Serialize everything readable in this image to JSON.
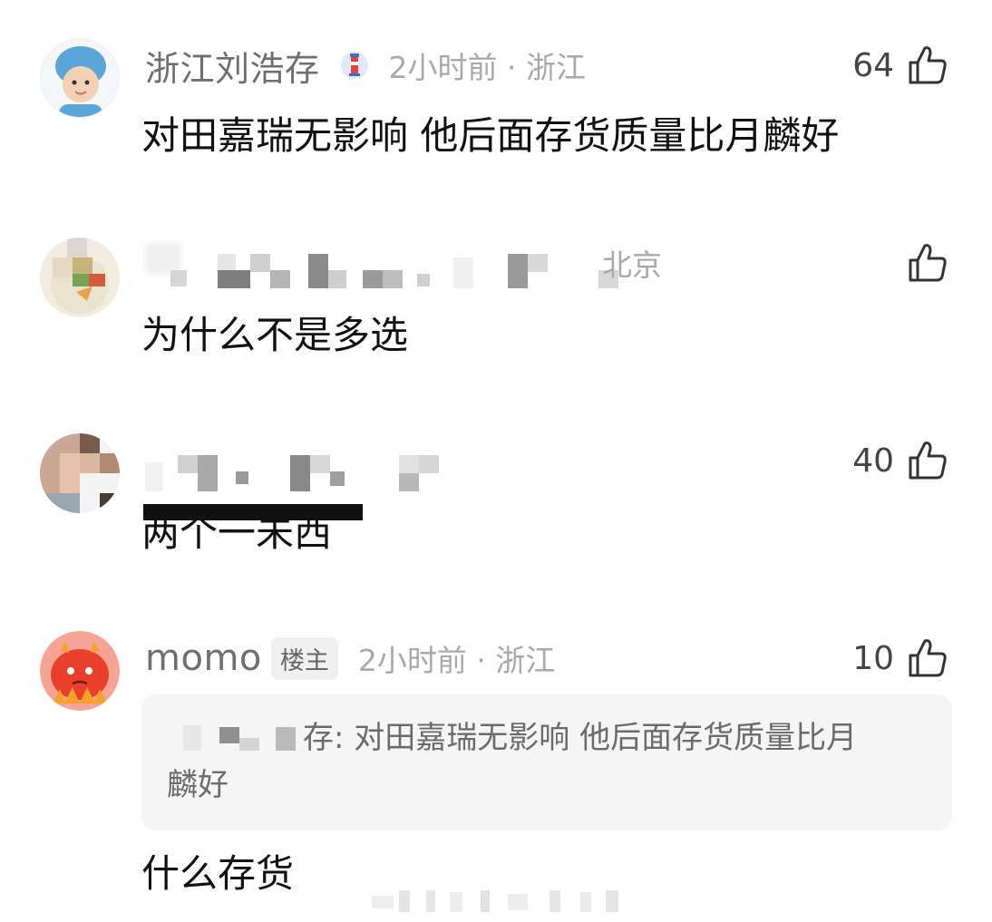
{
  "comments": [
    {
      "username": "浙江刘浩存",
      "time_location": "2小时前 · 浙江",
      "likes": "64",
      "text": "对田嘉瑞无影响 他后面存货质量比月麟好",
      "badge_icon": "lighthouse-badge-icon"
    },
    {
      "username": "",
      "time_location": "北京",
      "likes": "",
      "text": "为什么不是多选"
    },
    {
      "username": "",
      "time_location": "",
      "likes": "40",
      "text": "两个一未西"
    },
    {
      "username": "momo",
      "op_tag": "楼主",
      "time_location": "2小时前 · 浙江",
      "likes": "10",
      "quote_text": "存: 对田嘉瑞无影响 他后面存货质量比月",
      "quote_text_line2": "麟好",
      "text": "什么存货"
    }
  ],
  "colors": {
    "username": "#6f6f6f",
    "meta": "#a9a9a9",
    "text": "#111111",
    "quote_bg": "#f5f5f5"
  }
}
